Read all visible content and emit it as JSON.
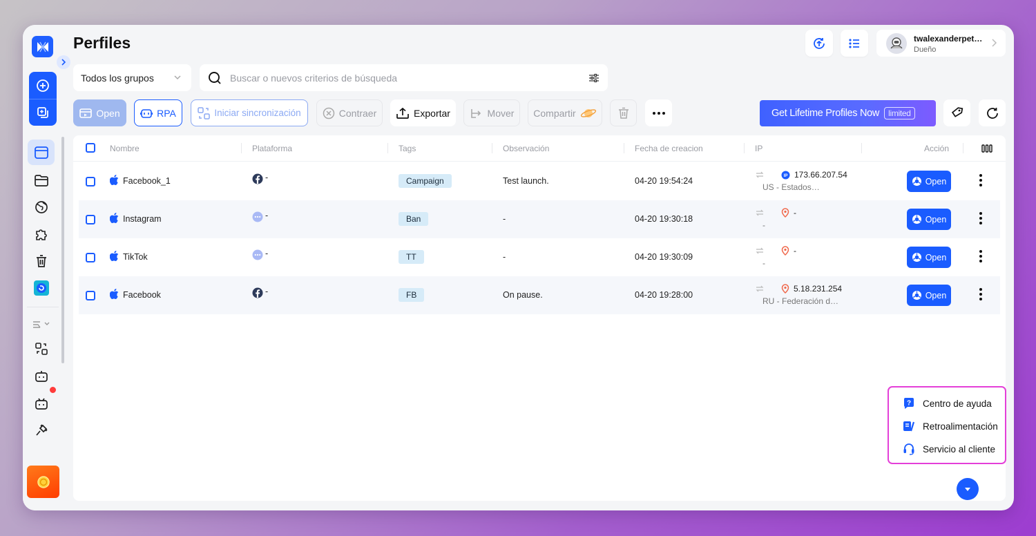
{
  "header": {
    "title": "Perfiles",
    "user": {
      "name": "twalexanderpet…",
      "role": "Dueño"
    }
  },
  "filters": {
    "group_select": "Todos los grupos",
    "search_placeholder": "Buscar o nuevos criterios de búsqueda"
  },
  "toolbar": {
    "open": "Open",
    "rpa": "RPA",
    "sync": "Iniciar sincronización",
    "collapse": "Contraer",
    "export": "Exportar",
    "move": "Mover",
    "share": "Compartir",
    "banner": "Get Lifetime Profiles Now",
    "banner_badge": "limited"
  },
  "table": {
    "columns": {
      "name": "Nombre",
      "platform": "Plataforma",
      "tags": "Tags",
      "note": "Observación",
      "created": "Fecha de creacion",
      "ip": "IP",
      "action": "Acción"
    },
    "rows": [
      {
        "name": "Facebook_1",
        "platform_icon": "facebook-icon",
        "platform": "-",
        "tag": "Campaign",
        "note": "Test launch.",
        "created": "04-20 19:54:24",
        "ip": "173.66.207.54",
        "ip_location": "US - Estados…",
        "ip_icon": "ip-badge-icon",
        "action": "Open"
      },
      {
        "name": "Instagram",
        "platform_icon": "more-platform-icon",
        "platform": "-",
        "tag": "Ban",
        "note": "-",
        "created": "04-20 19:30:18",
        "ip": "-",
        "ip_location": "-",
        "ip_icon": "location-pin-icon",
        "action": "Open"
      },
      {
        "name": "TikTok",
        "platform_icon": "more-platform-icon",
        "platform": "-",
        "tag": "TT",
        "note": "-",
        "created": "04-20 19:30:09",
        "ip": "-",
        "ip_location": "-",
        "ip_icon": "location-pin-icon",
        "action": "Open"
      },
      {
        "name": "Facebook",
        "platform_icon": "facebook-icon",
        "platform": "-",
        "tag": "FB",
        "note": "On pause.",
        "created": "04-20 19:28:00",
        "ip": "5.18.231.254",
        "ip_location": "RU - Federación d…",
        "ip_icon": "location-pin-icon",
        "action": "Open"
      }
    ]
  },
  "help_menu": {
    "items": [
      "Centro de ayuda",
      "Retroalimentación",
      "Servicio al cliente"
    ]
  },
  "colors": {
    "accent": "#1a5cff",
    "help_border": "#e43fd8",
    "tag_bg": "#d6ebf8",
    "ip_pin": "#f0684b"
  }
}
